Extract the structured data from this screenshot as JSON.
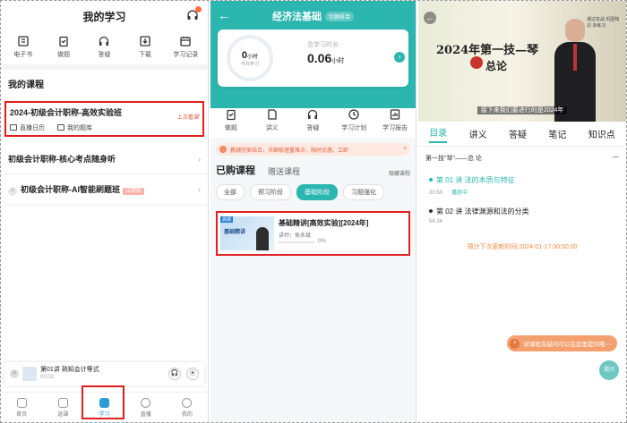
{
  "panel1": {
    "title": "我的学习",
    "grid": [
      "电子书",
      "做题",
      "答疑",
      "下载",
      "学习记录"
    ],
    "section_title": "我的课程",
    "course1": {
      "title": "2024-初级会计职称-高效实验班",
      "last": "上次看课",
      "meta1": "直播日历",
      "meta2": "我的题库"
    },
    "course2": {
      "title": "初级会计职称-核心考点随身听"
    },
    "course3": {
      "title": "初级会计职称-AI智能刷题班",
      "badge": "试用版"
    },
    "player": {
      "title": "第01讲  熟知会计等式",
      "time": "00:03",
      "close": "×",
      "btn1": "🎧",
      "btn2": "⦿"
    },
    "tabs": [
      "首页",
      "选课",
      "学习",
      "直播",
      "我的"
    ],
    "active_tab": "学习"
  },
  "panel2": {
    "nav_title": "经济法基础",
    "switch_label": "切换科目",
    "today_value": "0",
    "today_unit": "小时",
    "today_label": "今日学习",
    "total_label": "总学习时长",
    "total_value": "0.06",
    "total_unit": "小时",
    "grid": [
      "做题",
      "讲义",
      "答疑",
      "学习计划",
      "学习报告"
    ],
    "notice": "教辅完美结合，详细梳理重难点，限时优惠，立即",
    "tab_bought": "已购课程",
    "tab_gift": "赠送课程",
    "hide_label": "隐藏课程",
    "chips": [
      "全部",
      "预习阶段",
      "基础阶段",
      "习题强化"
    ],
    "active_chip": "基础阶段",
    "lesson": {
      "tag": "高频",
      "thumb_title": "基础精讲",
      "title": "基础精讲[高效实验][2024年]",
      "teacher": "讲师：侯永斌",
      "progress_text": "0%",
      "progress": 0
    }
  },
  "panel3": {
    "video_title_line1": "2024年第一技—琴",
    "video_title_line2": "总论",
    "video_side": "通过实战 巩固知识 多练习",
    "subtitle": "接下来我们要进行的是2024年",
    "tabs": [
      "目录",
      "讲义",
      "答疑",
      "笔记",
      "知识点"
    ],
    "active_tab": "目录",
    "chapter": "第一技\"琴\"——总  论",
    "lectures": [
      {
        "title": "第 01 讲   法的本质与特征",
        "time": "20:50",
        "status": "播放中"
      },
      {
        "title": "第 02 讲   法律渊源和法的分类",
        "time": "54:34",
        "status": ""
      }
    ],
    "next_update": "预计下次更新时间:2024-01-17 00:00:00",
    "ask_tip": "对课程有疑问可以在这里提问哦~~",
    "ask_button": "提问"
  },
  "colors": {
    "accent": "#2bb6b0",
    "highlight_box": "#e02020",
    "tab_blue": "#2b9bd6",
    "orange": "#f08a3c"
  }
}
